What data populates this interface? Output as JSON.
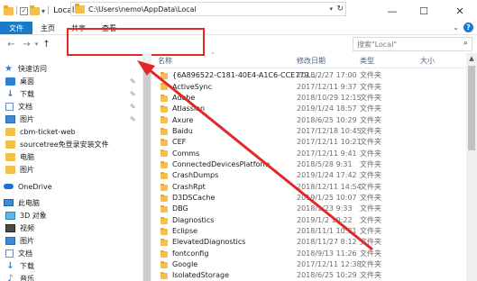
{
  "window": {
    "title": "Local",
    "minimize_glyph": "—",
    "maximize_glyph": "☐",
    "close_glyph": "✕"
  },
  "ribbon": {
    "tabs": [
      "文件",
      "主页",
      "共享",
      "查看"
    ]
  },
  "address": {
    "path": "C:\\Users\\nemo\\AppData\\Local",
    "refresh_glyph": "↻"
  },
  "search": {
    "placeholder": "搜索\"Local\""
  },
  "nav_pane": {
    "quick_access": "快速访问",
    "items": [
      {
        "label": "桌面",
        "icon": "desktop-icon",
        "pinned": true
      },
      {
        "label": "下载",
        "icon": "download-icon",
        "pinned": true
      },
      {
        "label": "文档",
        "icon": "document-icon",
        "pinned": true
      },
      {
        "label": "图片",
        "icon": "picture-icon",
        "pinned": true
      },
      {
        "label": "cbm-ticket-web",
        "icon": "folder-icon",
        "pinned": false
      },
      {
        "label": "sourcetree免登录安装文件",
        "icon": "folder-icon",
        "pinned": false
      },
      {
        "label": "电脑",
        "icon": "folder-icon",
        "pinned": false
      },
      {
        "label": "图片",
        "icon": "folder-icon",
        "pinned": false
      }
    ],
    "onedrive": "OneDrive",
    "this_pc": "此电脑",
    "pc_items": [
      {
        "label": "3D 对象",
        "icon": "3d-objects-icon"
      },
      {
        "label": "视频",
        "icon": "video-icon"
      },
      {
        "label": "图片",
        "icon": "picture-icon"
      },
      {
        "label": "文档",
        "icon": "document-icon"
      },
      {
        "label": "下载",
        "icon": "download-icon"
      },
      {
        "label": "音乐",
        "icon": "music-icon"
      }
    ]
  },
  "list": {
    "columns": {
      "name": "名称",
      "date": "修改日期",
      "type": "类型",
      "size": "大小"
    },
    "rows": [
      {
        "name": "{6A896522-C181-40E4-A1C6-CCE779...",
        "date": "2018/2/27 17:00",
        "type": "文件夹"
      },
      {
        "name": "ActiveSync",
        "date": "2017/12/11 9:37",
        "type": "文件夹"
      },
      {
        "name": "Adobe",
        "date": "2018/10/29 12:15",
        "type": "文件夹"
      },
      {
        "name": "Atlassian",
        "date": "2019/1/24 18:57",
        "type": "文件夹"
      },
      {
        "name": "Axure",
        "date": "2018/6/25 10:29",
        "type": "文件夹"
      },
      {
        "name": "Baidu",
        "date": "2017/12/18 10:45",
        "type": "文件夹"
      },
      {
        "name": "CEF",
        "date": "2017/12/11 10:21",
        "type": "文件夹"
      },
      {
        "name": "Comms",
        "date": "2017/12/11 9:41",
        "type": "文件夹"
      },
      {
        "name": "ConnectedDevicesPlatform",
        "date": "2018/5/28 9:31",
        "type": "文件夹"
      },
      {
        "name": "CrashDumps",
        "date": "2019/1/24 17:42",
        "type": "文件夹"
      },
      {
        "name": "CrashRpt",
        "date": "2018/12/11 14:54",
        "type": "文件夹"
      },
      {
        "name": "D3DSCache",
        "date": "2019/1/25 10:07",
        "type": "文件夹"
      },
      {
        "name": "DBG",
        "date": "2018/1/23 9:33",
        "type": "文件夹"
      },
      {
        "name": "Diagnostics",
        "date": "2019/1/2 10:22",
        "type": "文件夹"
      },
      {
        "name": "Eclipse",
        "date": "2018/11/1 10:31",
        "type": "文件夹"
      },
      {
        "name": "ElevatedDiagnostics",
        "date": "2018/11/27 8:12",
        "type": "文件夹"
      },
      {
        "name": "fontconfig",
        "date": "2018/9/13 11:26",
        "type": "文件夹"
      },
      {
        "name": "Google",
        "date": "2017/12/11 12:38",
        "type": "文件夹"
      },
      {
        "name": "IsolatedStorage",
        "date": "2018/6/25 10:29",
        "type": "文件夹"
      }
    ]
  },
  "colors": {
    "file_tab": "#1979ca",
    "annotation_red": "#e32626",
    "folder_yellow": "#f4c04d"
  }
}
